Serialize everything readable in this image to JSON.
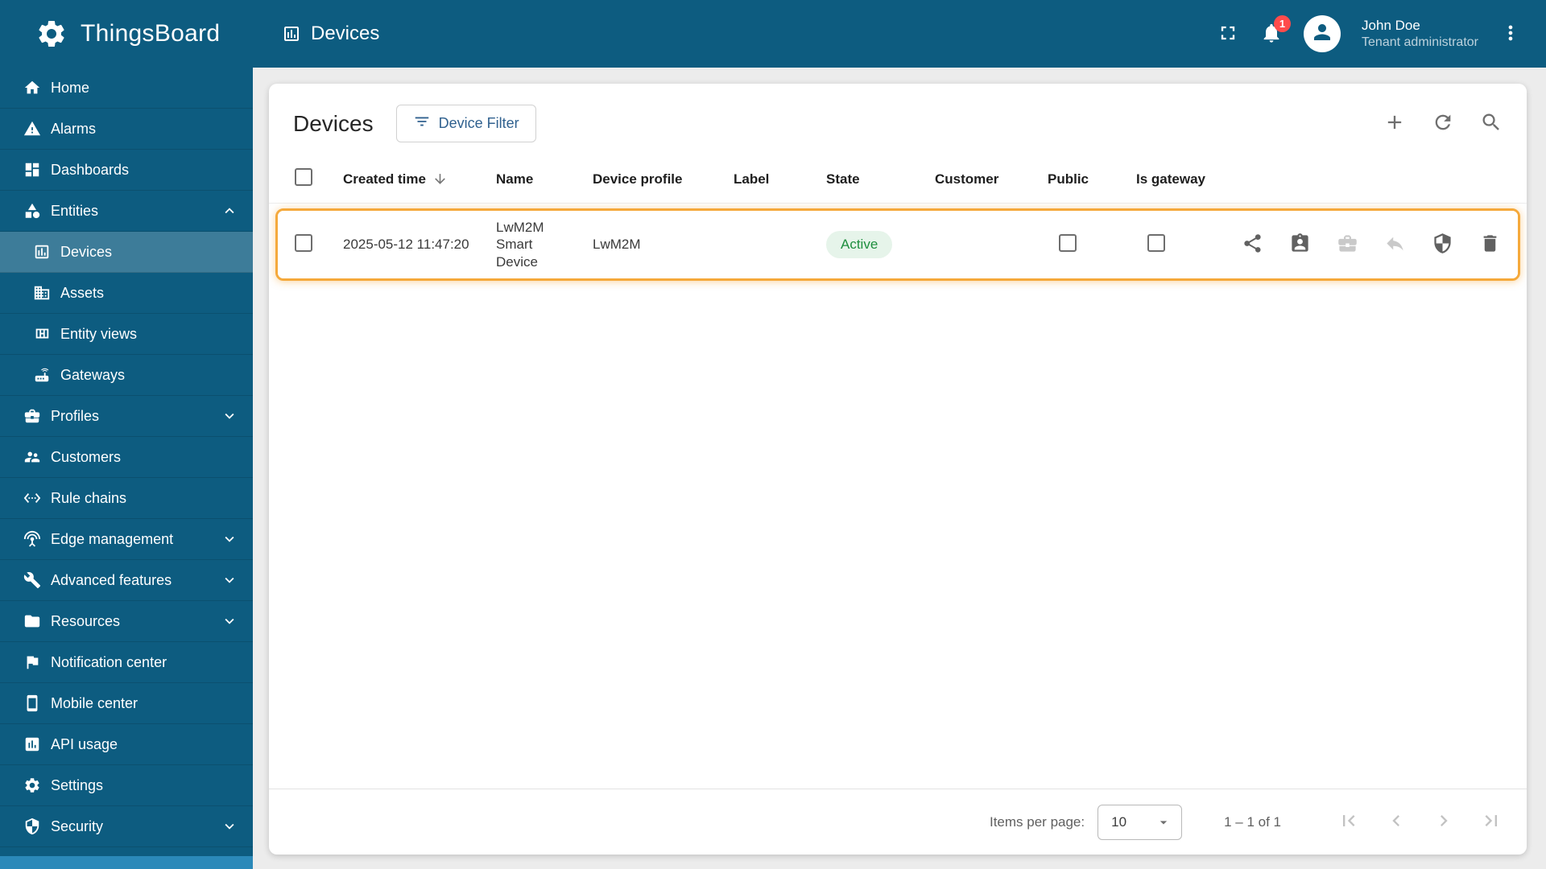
{
  "colors": {
    "primary": "#0d5c80",
    "sidebar_selected": "rgba(255,255,255,0.2)",
    "highlight_outline": "#f5a93b",
    "active_badge_bg": "#e6f4ea",
    "active_badge_text": "#1e8e3e",
    "notification_badge": "#ff4b4b",
    "button_text": "#30618f"
  },
  "header": {
    "brand": "ThingsBoard",
    "page_title": "Devices",
    "notifications_badge": "1",
    "user": {
      "name": "John Doe",
      "role": "Tenant administrator"
    },
    "icons": [
      "fullscreen-icon",
      "bell-icon",
      "avatar-icon",
      "kebab-menu-icon"
    ]
  },
  "sidebar": {
    "items": [
      {
        "label": "Home",
        "icon": "home-icon"
      },
      {
        "label": "Alarms",
        "icon": "warning-icon"
      },
      {
        "label": "Dashboards",
        "icon": "dashboard-icon"
      },
      {
        "label": "Entities",
        "icon": "category-icon",
        "expanded": true
      },
      {
        "label": "Devices",
        "icon": "devices-icon",
        "child": true,
        "selected": true
      },
      {
        "label": "Assets",
        "icon": "building-icon",
        "child": true
      },
      {
        "label": "Entity views",
        "icon": "view-quilt-icon",
        "child": true
      },
      {
        "label": "Gateways",
        "icon": "router-icon",
        "child": true
      },
      {
        "label": "Profiles",
        "icon": "briefcase-icon",
        "collapsed": true
      },
      {
        "label": "Customers",
        "icon": "people-icon"
      },
      {
        "label": "Rule chains",
        "icon": "ethernet-icon"
      },
      {
        "label": "Edge management",
        "icon": "antenna-icon",
        "collapsed": true
      },
      {
        "label": "Advanced features",
        "icon": "wrench-icon",
        "collapsed": true
      },
      {
        "label": "Resources",
        "icon": "folder-icon",
        "collapsed": true
      },
      {
        "label": "Notification center",
        "icon": "flag-icon"
      },
      {
        "label": "Mobile center",
        "icon": "smartphone-icon"
      },
      {
        "label": "API usage",
        "icon": "chart-icon"
      },
      {
        "label": "Settings",
        "icon": "gear-icon"
      },
      {
        "label": "Security",
        "icon": "shield-icon",
        "collapsed": true
      }
    ]
  },
  "content": {
    "title": "Devices",
    "filter_button_label": "Device Filter",
    "toolbar_icons": [
      "add-icon",
      "refresh-icon",
      "search-icon"
    ],
    "table": {
      "headers": [
        "Created time",
        "Name",
        "Device profile",
        "Label",
        "State",
        "Customer",
        "Public",
        "Is gateway"
      ],
      "sorted_by": "Created time",
      "sort_direction": "desc",
      "rows": [
        {
          "created_time": "2025-05-12 11:47:20",
          "name": "LwM2M Smart Device",
          "device_profile": "LwM2M",
          "label": "",
          "state": "Active",
          "customer": "",
          "public_checked": false,
          "is_gateway_checked": false,
          "highlighted": true,
          "actions": [
            {
              "name": "share",
              "enabled": true
            },
            {
              "name": "assign-to-customer",
              "enabled": true
            },
            {
              "name": "make-private",
              "enabled": false
            },
            {
              "name": "unassign-from-customer",
              "enabled": false
            },
            {
              "name": "manage-credentials",
              "enabled": true
            },
            {
              "name": "delete",
              "enabled": true
            }
          ]
        }
      ]
    },
    "paginator": {
      "items_per_page_label": "Items per page:",
      "page_size": "10",
      "range": "1 – 1 of 1"
    }
  }
}
